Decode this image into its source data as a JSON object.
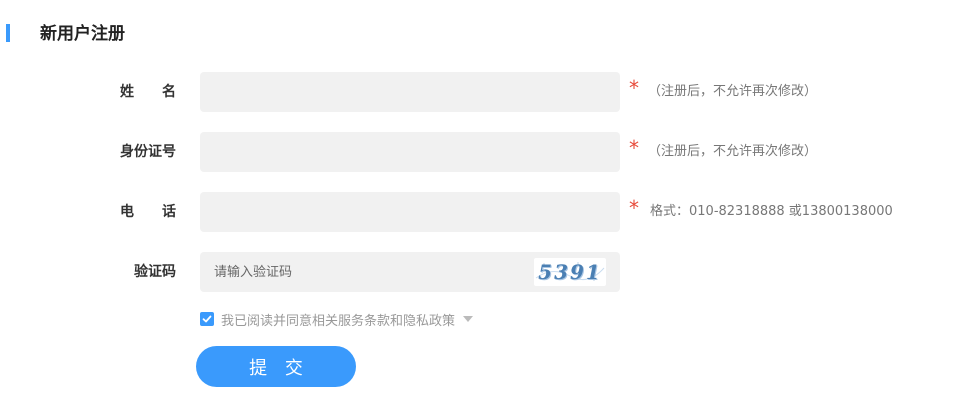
{
  "page": {
    "title": "新用户注册"
  },
  "form": {
    "name": {
      "label": "姓名",
      "value": "",
      "hint": "（注册后，不允许再次修改）",
      "required_mark": "*"
    },
    "id_number": {
      "label": "身份证号",
      "value": "",
      "hint": "（注册后，不允许再次修改）",
      "required_mark": "*"
    },
    "phone": {
      "label": "电话",
      "value": "",
      "hint": "格式：010-82318888 或13800138000",
      "required_mark": "*"
    },
    "captcha": {
      "label": "验证码",
      "placeholder": "请输入验证码",
      "image_text": "5391"
    },
    "agreement": {
      "checked": true,
      "text": "我已阅读并同意相关服务条款和隐私政策"
    },
    "submit_label": "提 交"
  },
  "colors": {
    "accent": "#3a9afc",
    "required": "#e74c3c",
    "field_bg": "#f1f1f1"
  },
  "icons": {
    "checkbox": "checkmark-icon",
    "expand": "caret-down-icon"
  }
}
